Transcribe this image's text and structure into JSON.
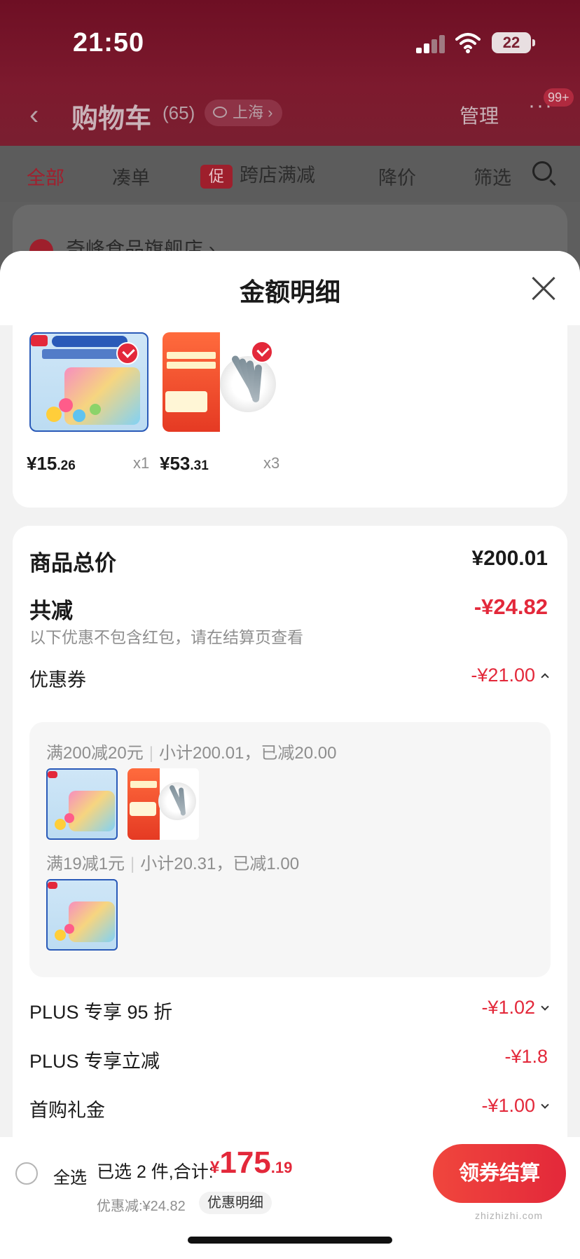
{
  "status_bar": {
    "time": "21:50",
    "battery": "22"
  },
  "background_app": {
    "title": "购物车",
    "count": "(65)",
    "location": "上海",
    "manage": "管理",
    "badge": "99+",
    "tabs": [
      {
        "label": "全部"
      },
      {
        "label": "凑单"
      },
      {
        "label": "跨店满减",
        "promo_icon": "促"
      },
      {
        "label": "降价"
      },
      {
        "label": "筛选"
      }
    ],
    "store_name": "奇峰食品旗舰店 ›"
  },
  "sheet": {
    "title": "金额明细",
    "products": [
      {
        "name": "candy-product",
        "price_int": "¥15",
        "price_dec": ".26",
        "qty": "x1"
      },
      {
        "name": "shrimp-product",
        "price_int": "¥53",
        "price_dec": ".31",
        "qty": "x3"
      }
    ],
    "summary": {
      "total_label": "商品总价",
      "total_value": "¥200.01",
      "reduce_label": "共减",
      "reduce_value": "-¥24.82",
      "reduce_note": "以下优惠不包含红包，请在结算页查看",
      "coupon_label": "优惠券",
      "coupon_value": "-¥21.00",
      "coupon_groups": [
        {
          "rule": "满200减20元",
          "detail": "小计200.01，已减20.00"
        },
        {
          "rule": "满19减1元",
          "detail": "小计20.31，已减1.00"
        }
      ],
      "plus_discount_label": "PLUS 专享 95 折",
      "plus_discount_value": "-¥1.02",
      "plus_reduce_label": "PLUS 专享立减",
      "plus_reduce_value": "-¥1.8",
      "first_buy_label": "首购礼金",
      "first_buy_value": "-¥1.00"
    }
  },
  "bottom_bar": {
    "select_all": "全选",
    "selected_text": "已选 2 件,合计:",
    "total_yen": "¥",
    "total_int": "175",
    "total_dec": ".19",
    "discount_text": "优惠减:¥24.82",
    "detail_button": "优惠明细",
    "checkout_button": "领券结算",
    "watermark": "zhizhizhi.com"
  },
  "colors": {
    "accent_red": "#e3283a",
    "overlay": "#5e5e5e"
  }
}
